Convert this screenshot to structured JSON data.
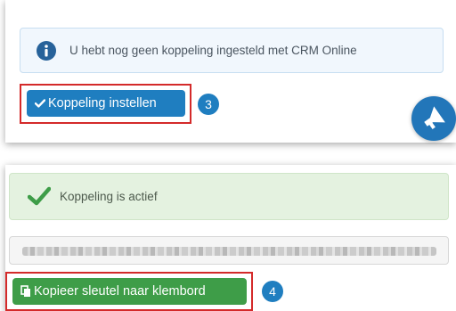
{
  "top_panel": {
    "info_alert_text": "U hebt nog geen koppeling ingesteld met CRM Online",
    "setup_button_label": "Koppeling instellen",
    "step_badge": "3"
  },
  "bottom_panel": {
    "success_alert_text": "Koppeling is actief",
    "copy_button_label": "Kopieer sleutel naar klembord",
    "step_badge": "4"
  },
  "icons": {
    "info": "info-circle-icon",
    "check": "check-icon",
    "copy": "copy-icon",
    "announce": "megaphone-icon"
  },
  "colors": {
    "primary": "#1f7ec0",
    "success": "#3e9d48",
    "highlight": "#d42a2a"
  }
}
